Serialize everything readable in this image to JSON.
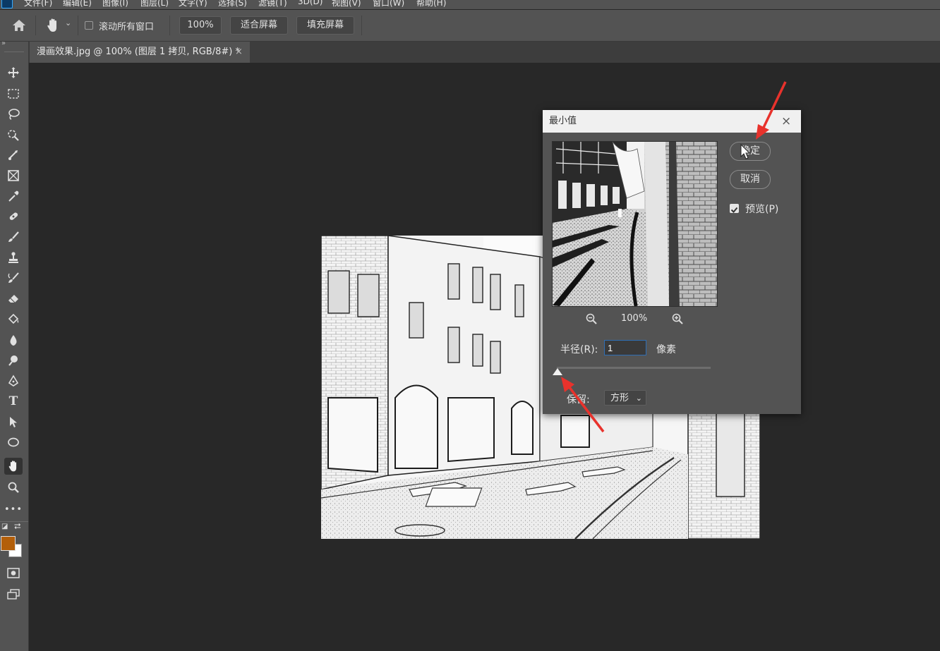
{
  "menu": [
    "文件(F)",
    "编辑(E)",
    "图像(I)",
    "图层(L)",
    "文字(Y)",
    "选择(S)",
    "滤镜(T)",
    "3D(D)",
    "视图(V)",
    "窗口(W)",
    "帮助(H)"
  ],
  "options": {
    "scroll_all_label": "滚动所有窗口",
    "zoom_value": "100%",
    "fit_screen": "适合屏幕",
    "fill_screen": "填充屏幕"
  },
  "tab": {
    "title": "漫画效果.jpg @ 100% (图层 1 拷贝, RGB/8#) *",
    "close": "×"
  },
  "dialog": {
    "title": "最小值",
    "close": "×",
    "ok": "确定",
    "cancel": "取消",
    "preview_label": "预览(P)",
    "preview_checked": true,
    "zoom_level": "100%",
    "radius_label": "半径(R):",
    "radius_value": "1",
    "radius_unit": "像素",
    "preserve_label": "保留:",
    "preserve_value": "方形"
  },
  "colors": {
    "foreground": "#b35f0a",
    "background": "#ffffff",
    "annotation_arrow": "#e8322c"
  },
  "tools": [
    "move-icon",
    "marquee-icon",
    "lasso-icon",
    "quick-select-icon",
    "crop-icon",
    "frame-icon",
    "eyedropper-icon",
    "healing-brush-icon",
    "brush-icon",
    "stamp-icon",
    "history-brush-icon",
    "eraser-icon",
    "paint-bucket-icon",
    "blur-icon",
    "dodge-icon",
    "pen-icon",
    "type-icon",
    "path-select-icon",
    "ellipse-icon",
    "hand-icon",
    "zoom-icon",
    "more-tools-icon"
  ]
}
